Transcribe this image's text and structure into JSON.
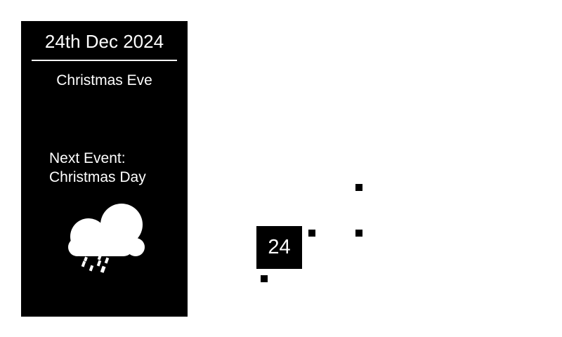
{
  "sidebar": {
    "date_title": "24th Dec 2024",
    "today_event": "Christmas Eve",
    "next_event_label": "Next Event:",
    "next_event_name": "Christmas Day",
    "weather_icon": "cloud-rain-icon"
  },
  "calendar": {
    "current_day": "24",
    "event_markers": 4
  },
  "colors": {
    "foreground": "#000000",
    "background": "#ffffff"
  }
}
